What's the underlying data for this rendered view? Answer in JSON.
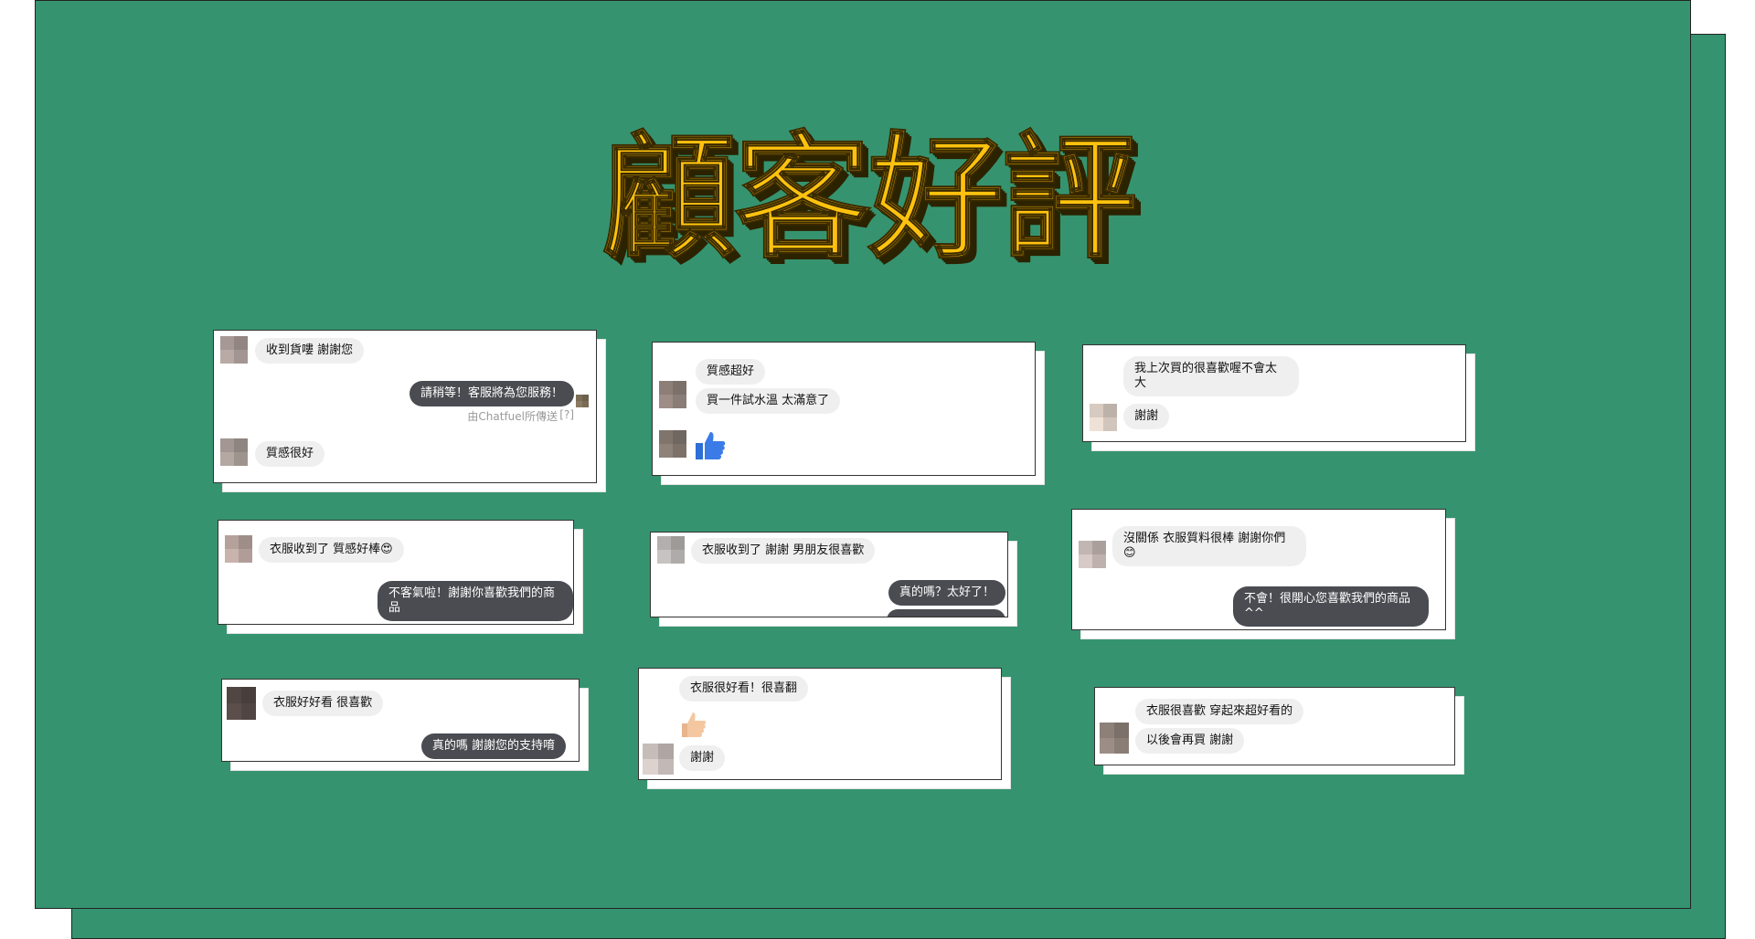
{
  "title": "顧客好評",
  "colors": {
    "background": "#35946f",
    "title": "#ffc20e",
    "incoming": "#efefef",
    "outgoing": "#4a4c52"
  },
  "cards": {
    "c1": {
      "m1": "收到貨嘍 謝謝您",
      "m2": "請稍等！客服將為您服務！",
      "m3": "由Chatfuel所傳送",
      "m4": "[?]",
      "m5": "質感很好"
    },
    "c2": {
      "m1": "質感超好",
      "m2": "買一件試水溫 太滿意了",
      "icon": "thumbs-up"
    },
    "c3": {
      "m1": "我上次買的很喜歡喔不會太大",
      "m2": "謝謝"
    },
    "c4": {
      "m1": "衣服收到了 質感好棒😍",
      "m2": "不客氣啦！謝謝你喜歡我們的商品"
    },
    "c5": {
      "m1": "衣服收到了 謝謝 男朋友很喜歡",
      "m2": "真的嗎？太好了！"
    },
    "c6": {
      "m1": "沒關係 衣服質料很棒 謝謝你們😊",
      "m2": "不會！很開心您喜歡我們的商品^^"
    },
    "c7": {
      "m1": "衣服好好看 很喜歡",
      "m2": "真的嗎 謝謝您的支持唷"
    },
    "c8": {
      "m1": "衣服很好看！很喜翻",
      "m2": "謝謝",
      "icon": "thumbs-up"
    },
    "c9": {
      "m1": "衣服很喜歡 穿起來超好看的",
      "m2": "以後會再買 謝謝"
    }
  }
}
